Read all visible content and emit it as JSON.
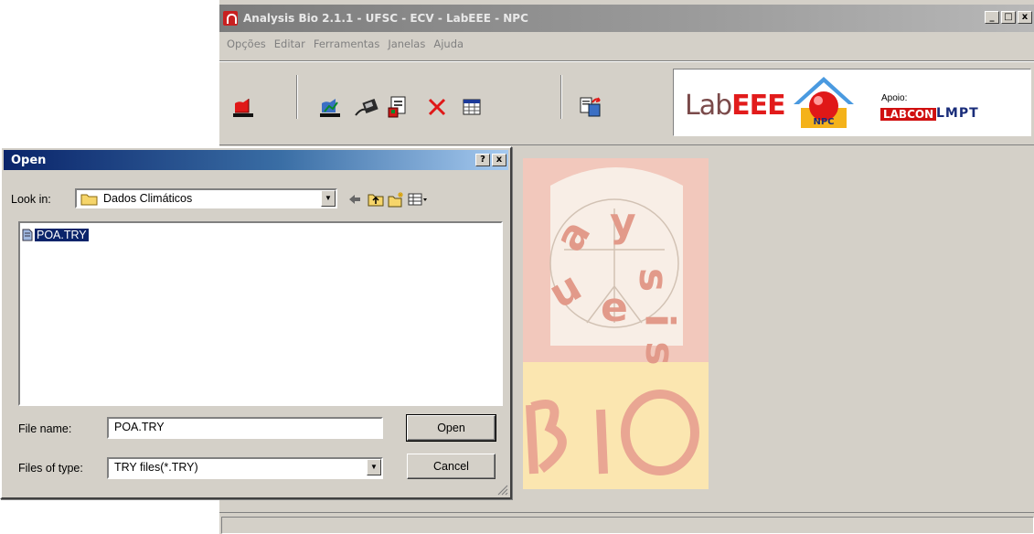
{
  "app": {
    "title": "Analysis Bio 2.1.1 - UFSC - ECV - LabEEE - NPC",
    "window_buttons": [
      "_",
      "□",
      "x"
    ],
    "menu": [
      "Opções",
      "Editar",
      "Ferramentas",
      "Janelas",
      "Ajuda"
    ],
    "toolbar_icons": [
      "open-file-icon",
      "chart-icon",
      "edit-icon",
      "save-icon",
      "delete-icon",
      "table-icon",
      "export-icon"
    ],
    "logos": {
      "lab": "Lab",
      "eee": "EEE",
      "npc": "NPC",
      "apoio": "Apoio:",
      "labcon": "LABCON",
      "lmpt": "LMPT"
    },
    "colors": {
      "accent_red": "#e21b1b",
      "lmpt_blue": "#1a2d7a"
    }
  },
  "dialog": {
    "title": "Open",
    "help_button": "?",
    "close_button": "x",
    "look_in_label": "Look in:",
    "look_in_value": "Dados Climáticos",
    "files": [
      {
        "name": "POA.TRY",
        "selected": true
      }
    ],
    "file_name_label": "File name:",
    "file_name_value": "POA.TRY",
    "files_of_type_label": "Files of type:",
    "files_of_type_value": "TRY files(*.TRY)",
    "open_button": "Open",
    "cancel_button": "Cancel"
  }
}
